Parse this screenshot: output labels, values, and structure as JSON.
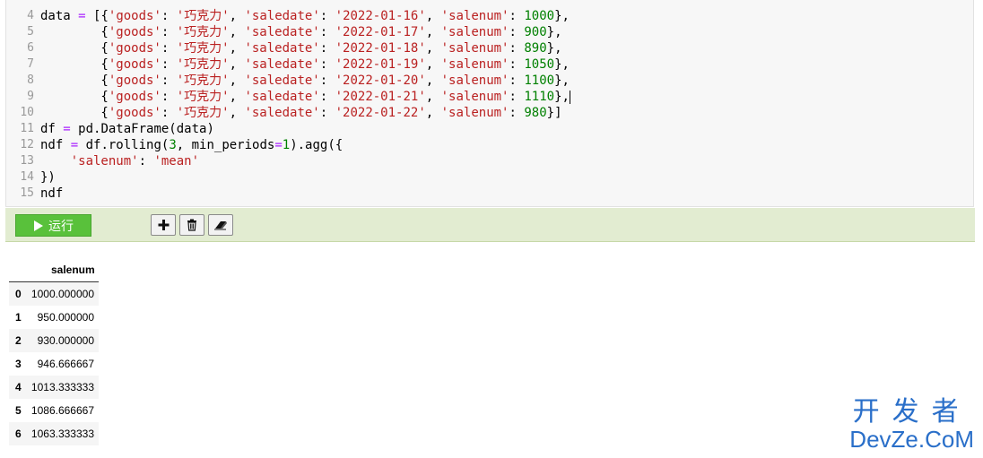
{
  "editor": {
    "line_numbers": [
      "4",
      "5",
      "6",
      "7",
      "8",
      "9",
      "10",
      "11",
      "12",
      "13",
      "14",
      "15"
    ],
    "lines": [
      [
        {
          "t": "data ",
          "c": ""
        },
        {
          "t": "=",
          "c": "o"
        },
        {
          "t": " [{",
          "c": ""
        },
        {
          "t": "'goods'",
          "c": "s"
        },
        {
          "t": ": ",
          "c": ""
        },
        {
          "t": "'巧克力'",
          "c": "s"
        },
        {
          "t": ", ",
          "c": ""
        },
        {
          "t": "'saledate'",
          "c": "s"
        },
        {
          "t": ": ",
          "c": ""
        },
        {
          "t": "'2022-01-16'",
          "c": "s"
        },
        {
          "t": ", ",
          "c": ""
        },
        {
          "t": "'salenum'",
          "c": "s"
        },
        {
          "t": ": ",
          "c": ""
        },
        {
          "t": "1000",
          "c": "n"
        },
        {
          "t": "},",
          "c": ""
        }
      ],
      [
        {
          "t": "        {",
          "c": ""
        },
        {
          "t": "'goods'",
          "c": "s"
        },
        {
          "t": ": ",
          "c": ""
        },
        {
          "t": "'巧克力'",
          "c": "s"
        },
        {
          "t": ", ",
          "c": ""
        },
        {
          "t": "'saledate'",
          "c": "s"
        },
        {
          "t": ": ",
          "c": ""
        },
        {
          "t": "'2022-01-17'",
          "c": "s"
        },
        {
          "t": ", ",
          "c": ""
        },
        {
          "t": "'salenum'",
          "c": "s"
        },
        {
          "t": ": ",
          "c": ""
        },
        {
          "t": "900",
          "c": "n"
        },
        {
          "t": "},",
          "c": ""
        }
      ],
      [
        {
          "t": "        {",
          "c": ""
        },
        {
          "t": "'goods'",
          "c": "s"
        },
        {
          "t": ": ",
          "c": ""
        },
        {
          "t": "'巧克力'",
          "c": "s"
        },
        {
          "t": ", ",
          "c": ""
        },
        {
          "t": "'saledate'",
          "c": "s"
        },
        {
          "t": ": ",
          "c": ""
        },
        {
          "t": "'2022-01-18'",
          "c": "s"
        },
        {
          "t": ", ",
          "c": ""
        },
        {
          "t": "'salenum'",
          "c": "s"
        },
        {
          "t": ": ",
          "c": ""
        },
        {
          "t": "890",
          "c": "n"
        },
        {
          "t": "},",
          "c": ""
        }
      ],
      [
        {
          "t": "        {",
          "c": ""
        },
        {
          "t": "'goods'",
          "c": "s"
        },
        {
          "t": ": ",
          "c": ""
        },
        {
          "t": "'巧克力'",
          "c": "s"
        },
        {
          "t": ", ",
          "c": ""
        },
        {
          "t": "'saledate'",
          "c": "s"
        },
        {
          "t": ": ",
          "c": ""
        },
        {
          "t": "'2022-01-19'",
          "c": "s"
        },
        {
          "t": ", ",
          "c": ""
        },
        {
          "t": "'salenum'",
          "c": "s"
        },
        {
          "t": ": ",
          "c": ""
        },
        {
          "t": "1050",
          "c": "n"
        },
        {
          "t": "},",
          "c": ""
        }
      ],
      [
        {
          "t": "        {",
          "c": ""
        },
        {
          "t": "'goods'",
          "c": "s"
        },
        {
          "t": ": ",
          "c": ""
        },
        {
          "t": "'巧克力'",
          "c": "s"
        },
        {
          "t": ", ",
          "c": ""
        },
        {
          "t": "'saledate'",
          "c": "s"
        },
        {
          "t": ": ",
          "c": ""
        },
        {
          "t": "'2022-01-20'",
          "c": "s"
        },
        {
          "t": ", ",
          "c": ""
        },
        {
          "t": "'salenum'",
          "c": "s"
        },
        {
          "t": ": ",
          "c": ""
        },
        {
          "t": "1100",
          "c": "n"
        },
        {
          "t": "},",
          "c": ""
        }
      ],
      [
        {
          "t": "        {",
          "c": ""
        },
        {
          "t": "'goods'",
          "c": "s"
        },
        {
          "t": ": ",
          "c": ""
        },
        {
          "t": "'巧克力'",
          "c": "s"
        },
        {
          "t": ", ",
          "c": ""
        },
        {
          "t": "'saledate'",
          "c": "s"
        },
        {
          "t": ": ",
          "c": ""
        },
        {
          "t": "'2022-01-21'",
          "c": "s"
        },
        {
          "t": ", ",
          "c": ""
        },
        {
          "t": "'salenum'",
          "c": "s"
        },
        {
          "t": ": ",
          "c": ""
        },
        {
          "t": "1110",
          "c": "n"
        },
        {
          "t": "},",
          "c": ""
        }
      ],
      [
        {
          "t": "        {",
          "c": ""
        },
        {
          "t": "'goods'",
          "c": "s"
        },
        {
          "t": ": ",
          "c": ""
        },
        {
          "t": "'巧克力'",
          "c": "s"
        },
        {
          "t": ", ",
          "c": ""
        },
        {
          "t": "'saledate'",
          "c": "s"
        },
        {
          "t": ": ",
          "c": ""
        },
        {
          "t": "'2022-01-22'",
          "c": "s"
        },
        {
          "t": ", ",
          "c": ""
        },
        {
          "t": "'salenum'",
          "c": "s"
        },
        {
          "t": ": ",
          "c": ""
        },
        {
          "t": "980",
          "c": "n"
        },
        {
          "t": "}]",
          "c": ""
        }
      ],
      [
        {
          "t": "df ",
          "c": ""
        },
        {
          "t": "=",
          "c": "o"
        },
        {
          "t": " pd.DataFrame(data)",
          "c": ""
        }
      ],
      [
        {
          "t": "ndf ",
          "c": ""
        },
        {
          "t": "=",
          "c": "o"
        },
        {
          "t": " df.rolling(",
          "c": ""
        },
        {
          "t": "3",
          "c": "n"
        },
        {
          "t": ", min_periods",
          "c": ""
        },
        {
          "t": "=",
          "c": "o"
        },
        {
          "t": "1",
          "c": "n"
        },
        {
          "t": ").agg({",
          "c": ""
        }
      ],
      [
        {
          "t": "    ",
          "c": ""
        },
        {
          "t": "'salenum'",
          "c": "s"
        },
        {
          "t": ": ",
          "c": ""
        },
        {
          "t": "'mean'",
          "c": "s"
        }
      ],
      [
        {
          "t": "})",
          "c": ""
        }
      ],
      [
        {
          "t": "ndf",
          "c": ""
        }
      ]
    ]
  },
  "toolbar": {
    "run_label": "运行",
    "add_icon": "plus-icon",
    "delete_icon": "trash-icon",
    "clear_icon": "eraser-icon",
    "run_color": "#59c13b",
    "bar_color": "#e2ecd1"
  },
  "output": {
    "column_header": "salenum",
    "rows": [
      {
        "index": "0",
        "value": "1000.000000"
      },
      {
        "index": "1",
        "value": "950.000000"
      },
      {
        "index": "2",
        "value": "930.000000"
      },
      {
        "index": "3",
        "value": "946.666667"
      },
      {
        "index": "4",
        "value": "1013.333333"
      },
      {
        "index": "5",
        "value": "1086.666667"
      },
      {
        "index": "6",
        "value": "1063.333333"
      }
    ]
  },
  "watermark": {
    "line1": "开发者",
    "line2": "DevZe.CoM",
    "color": "#2a6fc9"
  }
}
